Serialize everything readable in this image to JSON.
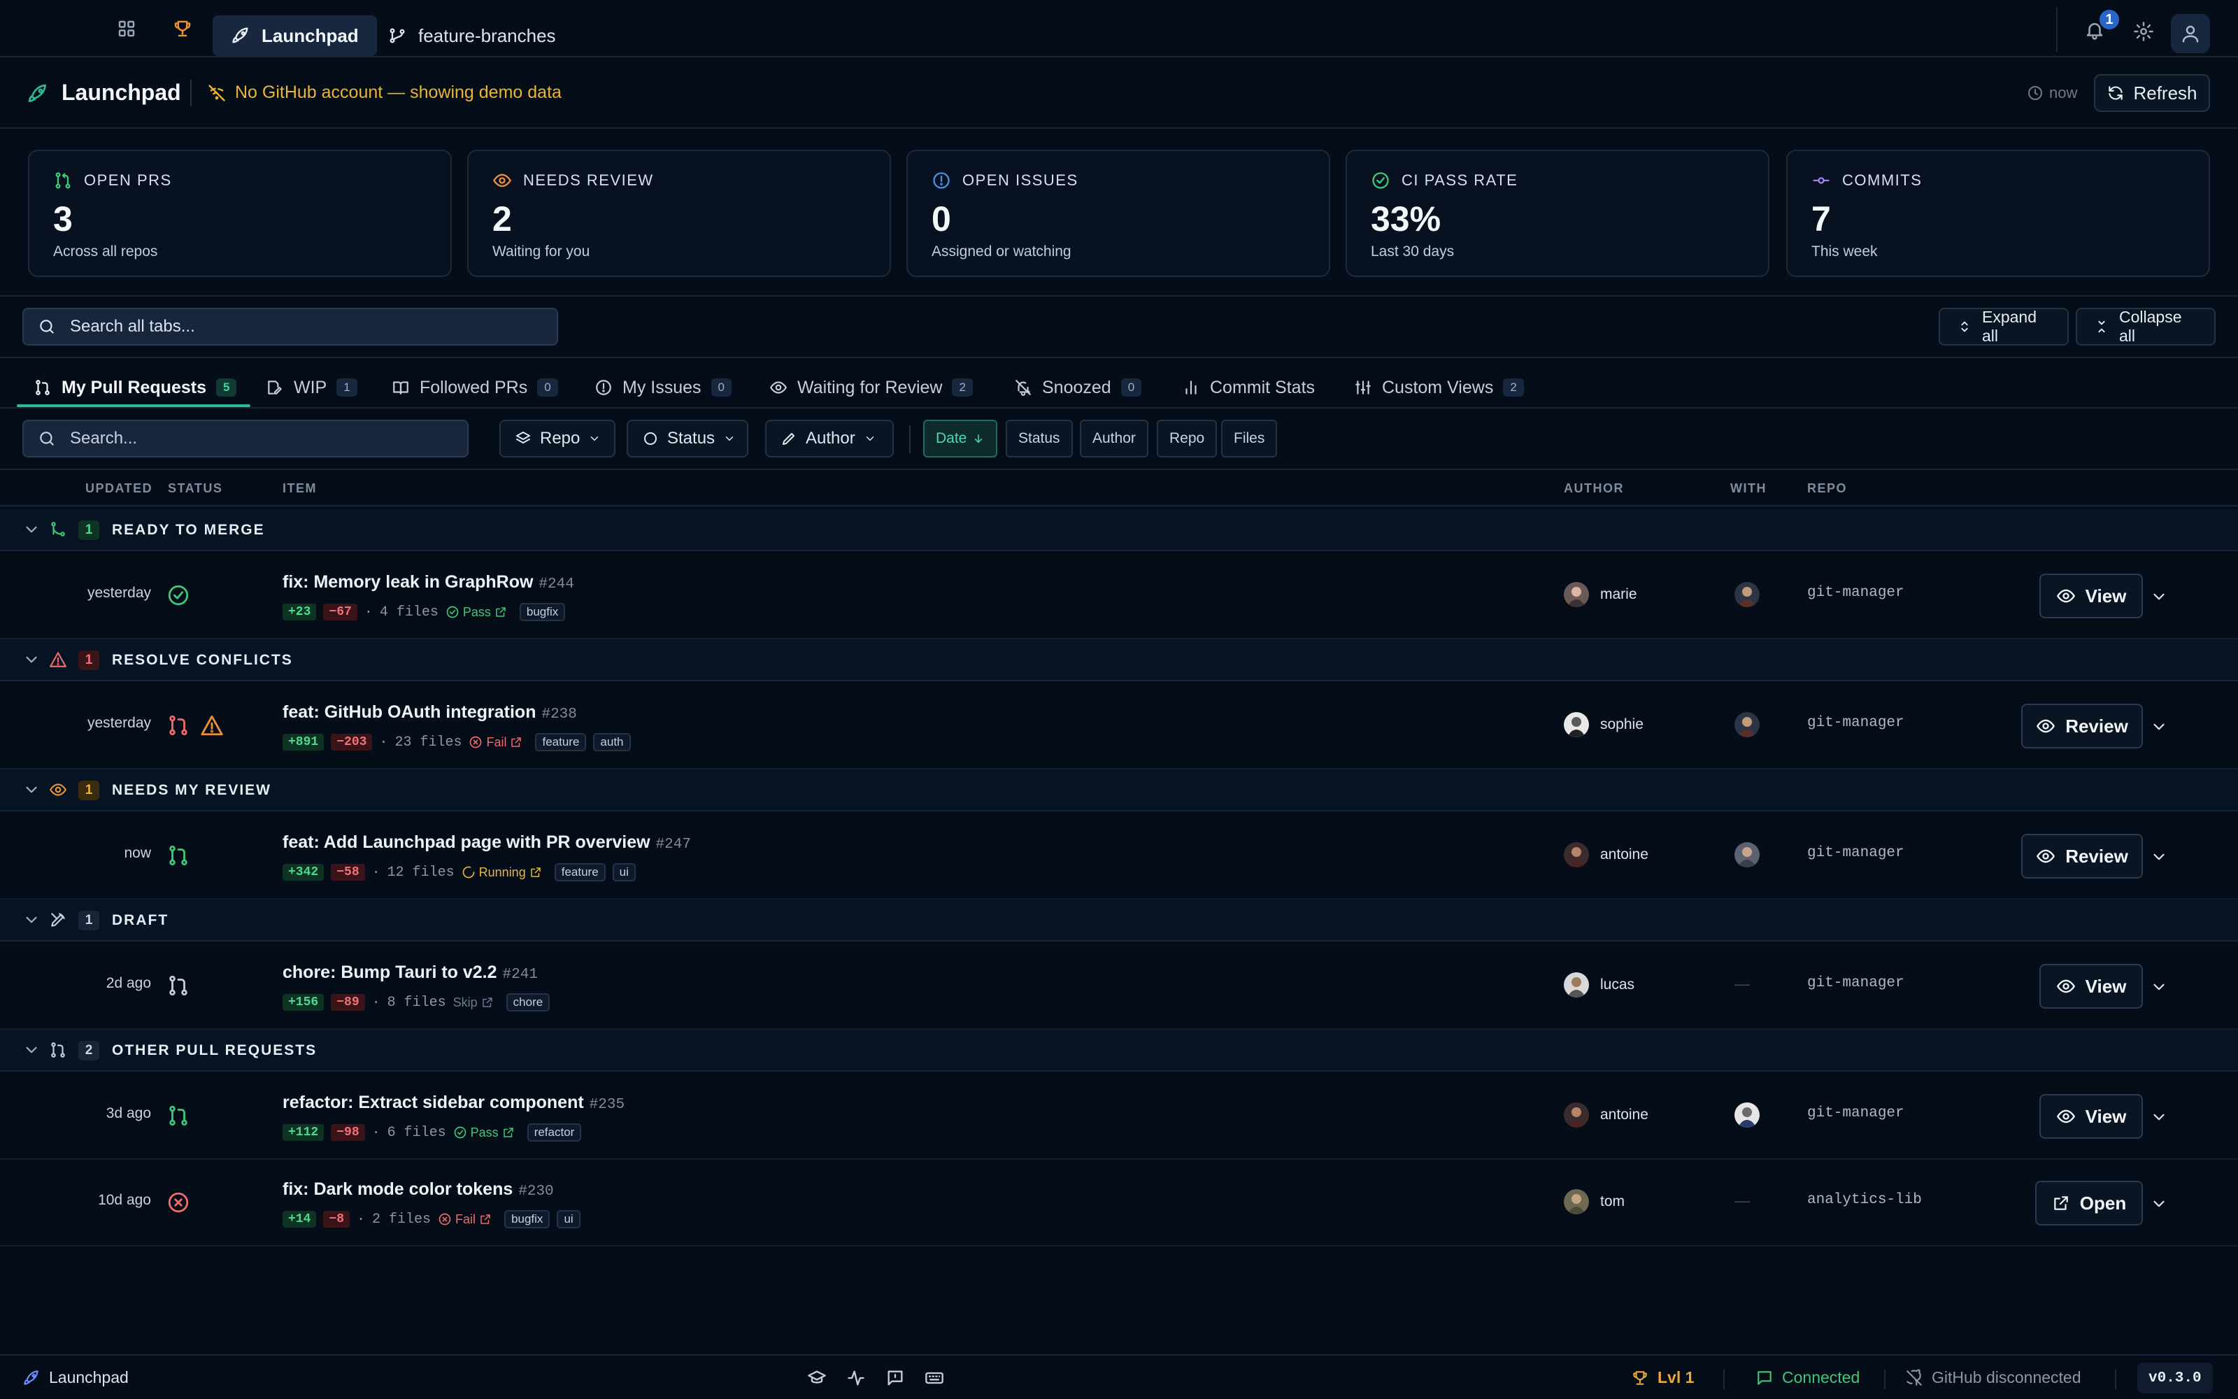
{
  "topbar": {
    "tabs": [
      {
        "label": "Launchpad"
      },
      {
        "label": "feature-branches"
      }
    ],
    "notifications_count": "1"
  },
  "header": {
    "title": "Launchpad",
    "warning": "No GitHub account — showing demo data",
    "refreshed": "now",
    "refresh_label": "Refresh"
  },
  "stats": [
    {
      "label": "OPEN PRS",
      "value": "3",
      "sub": "Across all repos",
      "icon": "pr-icon",
      "color": "#3fc77a"
    },
    {
      "label": "NEEDS REVIEW",
      "value": "2",
      "sub": "Waiting for you",
      "icon": "eye-icon",
      "color": "#e8913a"
    },
    {
      "label": "OPEN ISSUES",
      "value": "0",
      "sub": "Assigned or watching",
      "icon": "issue-icon",
      "color": "#4a90e2"
    },
    {
      "label": "CI PASS RATE",
      "value": "33%",
      "sub": "Last 30 days",
      "icon": "check-circle-icon",
      "color": "#3fc77a"
    },
    {
      "label": "COMMITS",
      "value": "7",
      "sub": "This week",
      "icon": "commit-icon",
      "color": "#a77ef0"
    }
  ],
  "search": {
    "placeholder": "Search all tabs..."
  },
  "expand_label": "Expand all",
  "collapse_label": "Collapse all",
  "section_tabs": [
    {
      "label": "My Pull Requests",
      "count": "5"
    },
    {
      "label": "WIP",
      "count": "1"
    },
    {
      "label": "Followed PRs",
      "count": "0"
    },
    {
      "label": "My Issues",
      "count": "0"
    },
    {
      "label": "Waiting for Review",
      "count": "2"
    },
    {
      "label": "Snoozed",
      "count": "0"
    },
    {
      "label": "Commit Stats",
      "count": ""
    },
    {
      "label": "Custom Views",
      "count": "2"
    }
  ],
  "filters": {
    "search_placeholder": "Search...",
    "dropdowns": [
      "Repo",
      "Status",
      "Author"
    ],
    "sort": [
      "Date",
      "Status",
      "Author",
      "Repo",
      "Files"
    ]
  },
  "columns": {
    "updated": "UPDATED",
    "status": "STATUS",
    "item": "ITEM",
    "author": "AUTHOR",
    "with": "WITH",
    "repo": "REPO"
  },
  "groups": [
    {
      "label": "READY TO MERGE",
      "count": "1"
    },
    {
      "label": "RESOLVE CONFLICTS",
      "count": "1"
    },
    {
      "label": "NEEDS MY REVIEW",
      "count": "1"
    },
    {
      "label": "DRAFT",
      "count": "1"
    },
    {
      "label": "OTHER PULL REQUESTS",
      "count": "2"
    }
  ],
  "rows": [
    {
      "updated": "yesterday",
      "title": "fix: Memory leak in GraphRow",
      "number": "#244",
      "additions": "+23",
      "deletions": "−67",
      "files": "4 files",
      "ci": "Pass",
      "tags": [
        "bugfix"
      ],
      "author": "marie",
      "with": "",
      "repo": "git-manager",
      "action": "View"
    },
    {
      "updated": "yesterday",
      "title": "feat: GitHub OAuth integration",
      "number": "#238",
      "additions": "+891",
      "deletions": "−203",
      "files": "23 files",
      "ci": "Fail",
      "tags": [
        "feature",
        "auth"
      ],
      "author": "sophie",
      "with": "",
      "repo": "git-manager",
      "action": "Review"
    },
    {
      "updated": "now",
      "title": "feat: Add Launchpad page with PR overview",
      "number": "#247",
      "additions": "+342",
      "deletions": "−58",
      "files": "12 files",
      "ci": "Running",
      "tags": [
        "feature",
        "ui"
      ],
      "author": "antoine",
      "with": "",
      "repo": "git-manager",
      "action": "Review"
    },
    {
      "updated": "2d ago",
      "title": "chore: Bump Tauri to v2.2",
      "number": "#241",
      "additions": "+156",
      "deletions": "−89",
      "files": "8 files",
      "ci": "Skip",
      "tags": [
        "chore"
      ],
      "author": "lucas",
      "with": "—",
      "repo": "git-manager",
      "action": "View"
    },
    {
      "updated": "3d ago",
      "title": "refactor: Extract sidebar component",
      "number": "#235",
      "additions": "+112",
      "deletions": "−98",
      "files": "6 files",
      "ci": "Pass",
      "tags": [
        "refactor"
      ],
      "author": "antoine",
      "with": "",
      "repo": "git-manager",
      "action": "View"
    },
    {
      "updated": "10d ago",
      "title": "fix: Dark mode color tokens",
      "number": "#230",
      "additions": "+14",
      "deletions": "−8",
      "files": "2 files",
      "ci": "Fail",
      "tags": [
        "bugfix",
        "ui"
      ],
      "author": "tom",
      "with": "—",
      "repo": "analytics-lib",
      "action": "Open"
    }
  ],
  "statusbar": {
    "app": "Launchpad",
    "level": "Lvl 1",
    "connection": "Connected",
    "github": "GitHub disconnected",
    "version": "v0.3.0"
  },
  "colors": {
    "accent": "#2fb88f",
    "warning": "#e8b53a",
    "success": "#3fc77a",
    "danger": "#f06b6b",
    "background": "#050d18"
  }
}
